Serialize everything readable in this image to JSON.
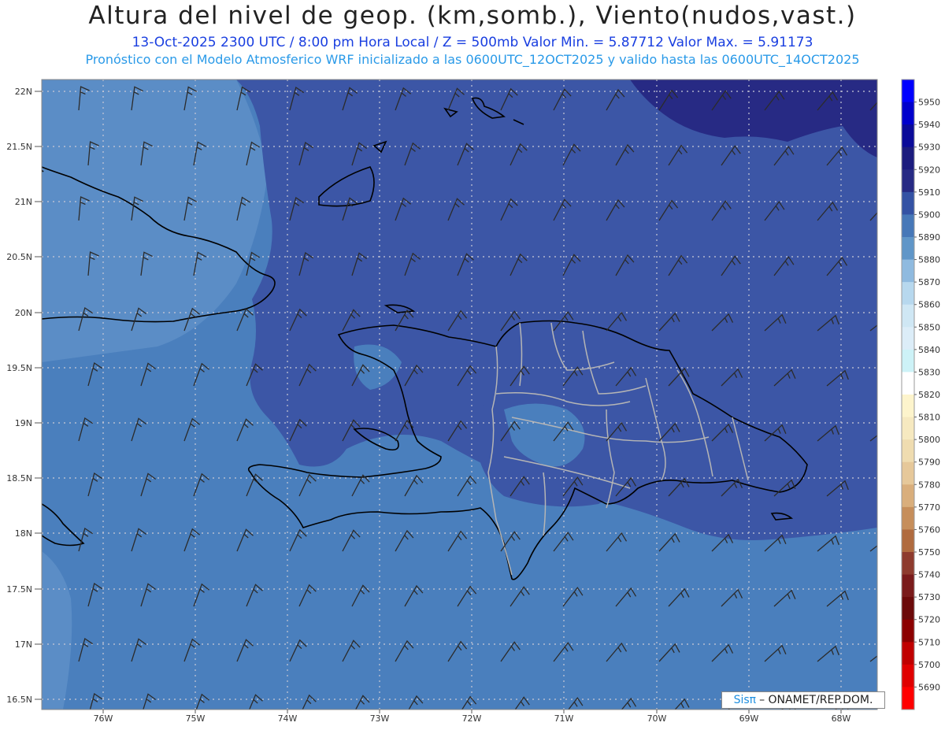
{
  "header": {
    "title": "Altura del nivel de geop. (km,somb.), Viento(nudos,vast.)",
    "subtitle1": "13-Oct-2025  2300 UTC / 8:00 pm Hora Local / Z = 500mb     Valor Min. = 5.87712  Valor Max. = 5.91173",
    "subtitle2": "Pronóstico con el Modelo Atmosferico WRF inicializado a las 0600UTC_12OCT2025 y valido hasta las  0600UTC_14OCT2025"
  },
  "map": {
    "lat_labels": [
      "22N",
      "21.5N",
      "21N",
      "20.5N",
      "20N",
      "19.5N",
      "19N",
      "18.5N",
      "18N",
      "17.5N",
      "17N",
      "16.5N"
    ],
    "lon_labels": [
      "76W",
      "75W",
      "74W",
      "73W",
      "72W",
      "71W",
      "70W",
      "69W",
      "68W"
    ],
    "colors": {
      "land_line": "#000000",
      "province_line": "#b5b5b5",
      "grid_line": "#c9c9d6",
      "barb": "#2b2b2b"
    }
  },
  "colorbar": {
    "levels": [
      "5950",
      "5940",
      "5930",
      "5920",
      "5910",
      "5900",
      "5890",
      "5880",
      "5870",
      "5860",
      "5850",
      "5840",
      "5830",
      "5820",
      "5810",
      "5800",
      "5790",
      "5780",
      "5770",
      "5760",
      "5750",
      "5740",
      "5730",
      "5720",
      "5710",
      "5700",
      "5690"
    ],
    "colors": [
      "#0000ff",
      "#0000cc",
      "#0b0b99",
      "#1c1c7e",
      "#272a84",
      "#3452a4",
      "#4778b8",
      "#6096c8",
      "#8fbadf",
      "#b7d8ee",
      "#cfe7f4",
      "#dcedf8",
      "#cdf2f7",
      "#ffffff",
      "#fdf4cc",
      "#f6e9c0",
      "#efdcb0",
      "#e6c89a",
      "#d9ae7c",
      "#c68e5b",
      "#b06b3f",
      "#8e3b2e",
      "#7a1b1b",
      "#6c0a0a",
      "#8c0000",
      "#c00000",
      "#e00000",
      "#ff0000"
    ]
  },
  "credit": {
    "brand": "Sisπ",
    "org": "– ONAMET/REP.DOM."
  }
}
